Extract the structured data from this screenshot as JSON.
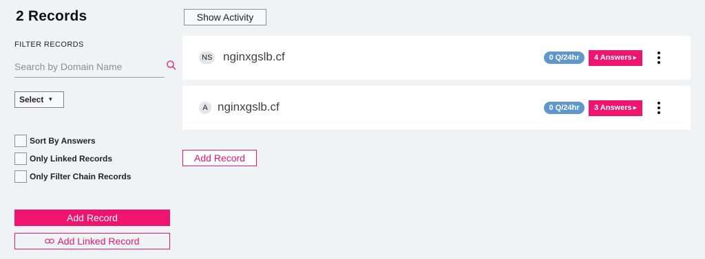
{
  "sidebar": {
    "title": "2 Records",
    "filter_label": "FILTER RECORDS",
    "search_placeholder": "Search by Domain Name",
    "search_value": "",
    "select_label": "Select",
    "checkboxes": [
      {
        "label": "Sort By Answers",
        "checked": false
      },
      {
        "label": "Only Linked Records",
        "checked": false
      },
      {
        "label": "Only Filter Chain Records",
        "checked": false
      }
    ],
    "add_record_label": "Add Record",
    "add_linked_record_label": "Add Linked Record"
  },
  "main": {
    "show_activity_label": "Show Activity",
    "records": [
      {
        "type": "NS",
        "domain": "nginxgslb.cf",
        "qps": "0 Q/24hr",
        "answers": "4 Answers"
      },
      {
        "type": "A",
        "domain": "nginxgslb.cf",
        "qps": "0 Q/24hr",
        "answers": "3 Answers"
      }
    ],
    "add_record_label": "Add Record"
  },
  "colors": {
    "accent": "#ee1470",
    "qps_badge": "#5f97cc",
    "background": "#f0f3f4"
  },
  "icons": [
    "search-icon",
    "caret-down-icon",
    "link-icon",
    "triangle-right-icon",
    "kebab-menu-icon"
  ]
}
